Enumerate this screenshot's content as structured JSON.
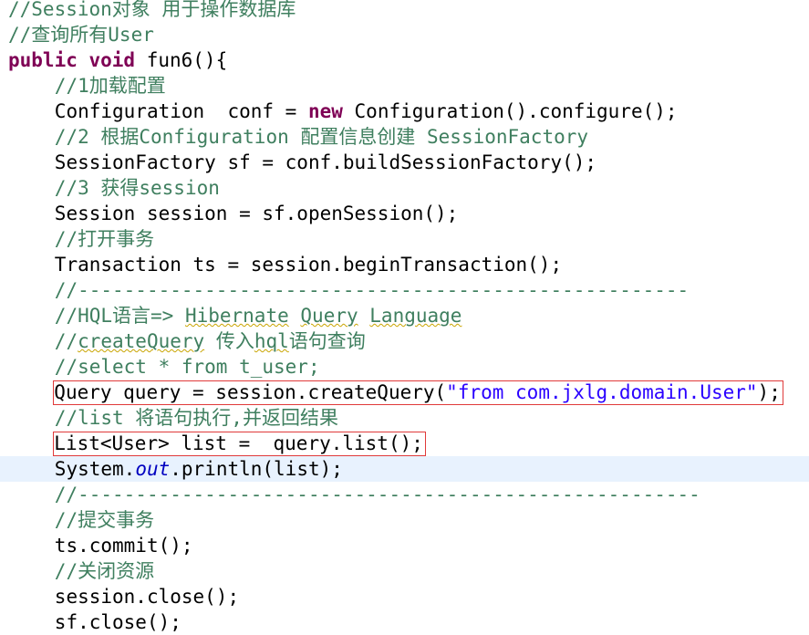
{
  "editor": {
    "colors": {
      "comment": "#3f7f5f",
      "keyword": "#7f0055",
      "string": "#2a00ff",
      "static_field": "#0000c0",
      "highlight_box": "#e03a3a",
      "current_line": "#e8f2fe"
    },
    "lines": [
      {
        "indent": 0,
        "tokens": [
          {
            "t": "cm",
            "v": "//Session对象 用于操作数据库"
          }
        ]
      },
      {
        "indent": 0,
        "tokens": [
          {
            "t": "cm",
            "v": "//查询所有User"
          }
        ]
      },
      {
        "indent": 0,
        "tokens": [
          {
            "t": "kw",
            "v": "public void"
          },
          {
            "t": "tx",
            "v": " fun6(){"
          }
        ]
      },
      {
        "indent": 4,
        "tokens": [
          {
            "t": "cm",
            "v": "//1加载配置"
          }
        ]
      },
      {
        "indent": 4,
        "tokens": [
          {
            "t": "tx",
            "v": "Configuration  conf = "
          },
          {
            "t": "kw",
            "v": "new"
          },
          {
            "t": "tx",
            "v": " Configuration().configure();"
          }
        ]
      },
      {
        "indent": 4,
        "tokens": [
          {
            "t": "cm",
            "v": "//2 根据Configuration 配置信息创建 SessionFactory"
          }
        ]
      },
      {
        "indent": 4,
        "tokens": [
          {
            "t": "tx",
            "v": "SessionFactory sf = conf.buildSessionFactory();"
          }
        ]
      },
      {
        "indent": 4,
        "tokens": [
          {
            "t": "cm",
            "v": "//3 获得session"
          }
        ]
      },
      {
        "indent": 4,
        "tokens": [
          {
            "t": "tx",
            "v": "Session session = sf.openSession();"
          }
        ]
      },
      {
        "indent": 4,
        "tokens": [
          {
            "t": "cm",
            "v": "//打开事务"
          }
        ]
      },
      {
        "indent": 4,
        "tokens": [
          {
            "t": "tx",
            "v": "Transaction ts = session.beginTransaction();"
          }
        ]
      },
      {
        "indent": 4,
        "tokens": [
          {
            "t": "cm",
            "v": "//-----------------------------------------------------"
          }
        ]
      },
      {
        "indent": 4,
        "tokens": [
          {
            "t": "cm",
            "v": "//HQL语言=> "
          },
          {
            "t": "cm sq",
            "v": "Hibernate"
          },
          {
            "t": "cm",
            "v": " "
          },
          {
            "t": "cm sq",
            "v": "Query"
          },
          {
            "t": "cm",
            "v": " "
          },
          {
            "t": "cm sq",
            "v": "Language"
          }
        ]
      },
      {
        "indent": 4,
        "tokens": [
          {
            "t": "cm",
            "v": "//"
          },
          {
            "t": "cm sq",
            "v": "createQuery"
          },
          {
            "t": "cm",
            "v": " 传入"
          },
          {
            "t": "cm sq",
            "v": "hql"
          },
          {
            "t": "cm",
            "v": "语句查询"
          }
        ]
      },
      {
        "indent": 4,
        "tokens": [
          {
            "t": "cm",
            "v": "//select * from t_user;"
          }
        ]
      },
      {
        "indent": 4,
        "highlight": true,
        "tokens": [
          {
            "t": "tx",
            "v": "Query query = session.createQuery("
          },
          {
            "t": "st",
            "v": "\"from com.jxlg.domain.User\""
          },
          {
            "t": "tx",
            "v": ");"
          }
        ]
      },
      {
        "indent": 4,
        "tokens": [
          {
            "t": "cm",
            "v": "//list 将语句执行,并返回结果"
          }
        ]
      },
      {
        "indent": 4,
        "highlight": true,
        "tokens": [
          {
            "t": "tx",
            "v": "List<User> list =  query.list();"
          }
        ]
      },
      {
        "indent": 4,
        "current": true,
        "tokens": [
          {
            "t": "tx",
            "v": "System."
          },
          {
            "t": "it",
            "v": "out"
          },
          {
            "t": "tx",
            "v": ".println(list);"
          }
        ]
      },
      {
        "indent": 4,
        "tokens": [
          {
            "t": "cm",
            "v": "//------------------------------------------------------"
          }
        ]
      },
      {
        "indent": 4,
        "tokens": [
          {
            "t": "cm",
            "v": "//提交事务"
          }
        ]
      },
      {
        "indent": 4,
        "tokens": [
          {
            "t": "tx",
            "v": "ts.commit();"
          }
        ]
      },
      {
        "indent": 4,
        "tokens": [
          {
            "t": "cm",
            "v": "//关闭资源"
          }
        ]
      },
      {
        "indent": 4,
        "tokens": [
          {
            "t": "tx",
            "v": "session.close();"
          }
        ]
      },
      {
        "indent": 4,
        "tokens": [
          {
            "t": "tx",
            "v": "sf.close();"
          }
        ]
      }
    ]
  }
}
